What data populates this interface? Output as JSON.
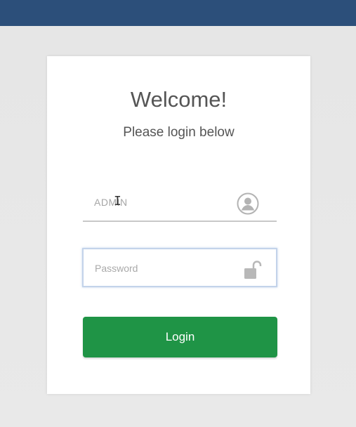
{
  "colors": {
    "top_bar": "#2c4f7a",
    "background": "#e8e8e8",
    "card": "#ffffff",
    "heading_text": "#555555",
    "button": "#1f9446",
    "button_text": "#ffffff"
  },
  "login": {
    "title": "Welcome!",
    "subtitle": "Please login below",
    "username": {
      "value": "ADMIN",
      "icon": "user-icon"
    },
    "password": {
      "placeholder": "Password",
      "value": "",
      "icon": "unlocked-lock-icon"
    },
    "button_label": "Login",
    "cursor_icon": "text-cursor-icon"
  }
}
